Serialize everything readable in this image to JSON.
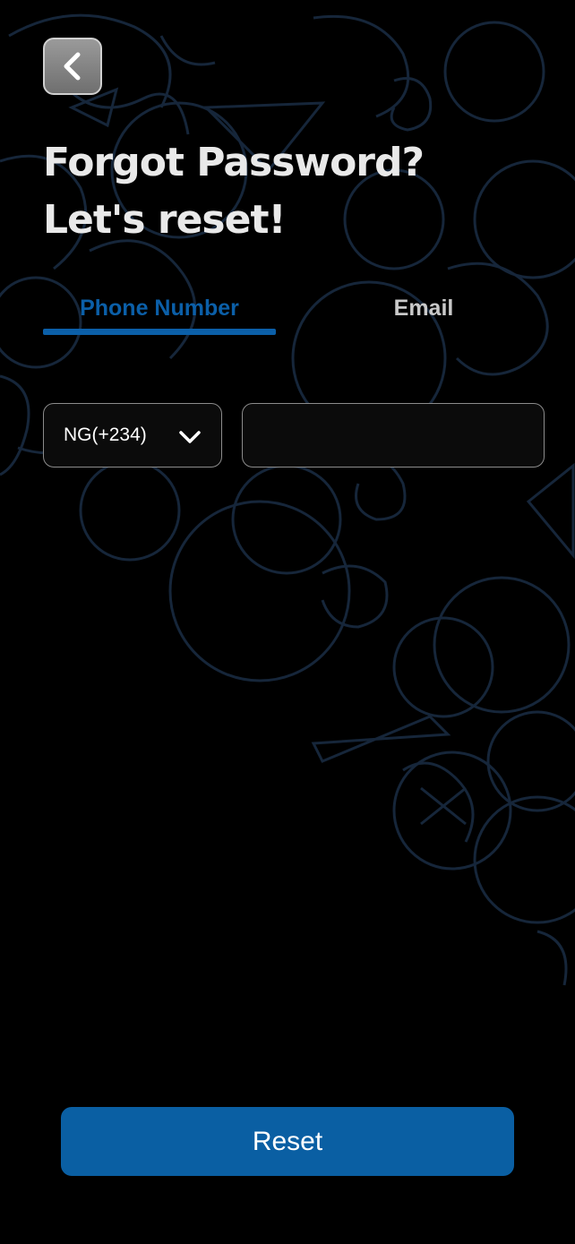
{
  "header": {
    "back_icon": "chevron-left-icon",
    "title_line1": "Forgot Password?",
    "title_line2": "Let's reset!"
  },
  "tabs": [
    {
      "label": "Phone Number",
      "active": true
    },
    {
      "label": "Email",
      "active": false
    }
  ],
  "form": {
    "country_code": "NG(+234)",
    "country_dropdown_icon": "chevron-down-icon",
    "phone_value": "",
    "phone_placeholder": ""
  },
  "actions": {
    "reset_label": "Reset"
  },
  "colors": {
    "background": "#000000",
    "accent": "#0a5fa3",
    "title_text": "#e9e9e9",
    "inactive_tab": "#c9c9c9",
    "pattern_stroke": "#16263a"
  }
}
